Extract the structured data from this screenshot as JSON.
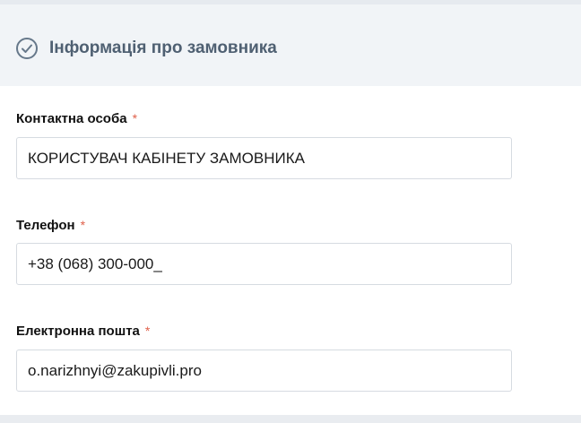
{
  "section": {
    "title": "Інформація про замовника",
    "icon": "check-circle-icon"
  },
  "fields": [
    {
      "label": "Контактна особа",
      "required_mark": "*",
      "value": "КОРИСТУВАЧ КАБІНЕТУ ЗАМОВНИКА"
    },
    {
      "label": "Телефон",
      "required_mark": "*",
      "value": "+38 (068) 300-000_"
    },
    {
      "label": "Електронна пошта",
      "required_mark": "*",
      "value": "o.narizhnyi@zakupivli.pro"
    }
  ],
  "colors": {
    "header_bg": "#f1f4f7",
    "title_text": "#4f6072",
    "required_mark": "#e0604a",
    "input_border": "#d6dbe1"
  }
}
